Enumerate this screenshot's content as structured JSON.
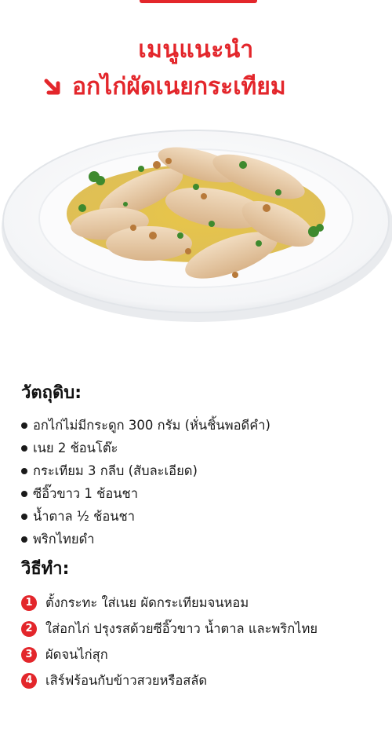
{
  "header": {
    "title": "เมนูแนะนำ",
    "subtitle": "อกไก่ผัดเนยกระเทียม",
    "arrow_icon": "arrow-down-right-icon",
    "accent_color": "#e3262b"
  },
  "image": {
    "subject": "dish-photo"
  },
  "ingredients": {
    "title": "วัตถุดิบ:",
    "items": [
      "อกไก่ไม่มีกระดูก 300 กรัม (หั่นชิ้นพอดีคำ)",
      "เนย 2 ช้อนโต๊ะ",
      "กระเทียม 3 กลีบ (สับละเอียด)",
      "ซีอิ๊วขาว 1 ช้อนชา",
      "น้ำตาล ½ ช้อนชา",
      "พริกไทยดำ"
    ]
  },
  "method": {
    "title": "วิธีทำ:",
    "steps": [
      {
        "num": "1",
        "text": "ตั้งกระทะ ใส่เนย ผัดกระเทียมจนหอม"
      },
      {
        "num": "2",
        "text": "ใส่อกไก่ ปรุงรสด้วยซีอิ๊วขาว น้ำตาล และพริกไทย"
      },
      {
        "num": "3",
        "text": "ผัดจนไก่สุก"
      },
      {
        "num": "4",
        "text": "เสิร์ฟร้อนกับข้าวสวยหรือสลัด"
      }
    ]
  }
}
